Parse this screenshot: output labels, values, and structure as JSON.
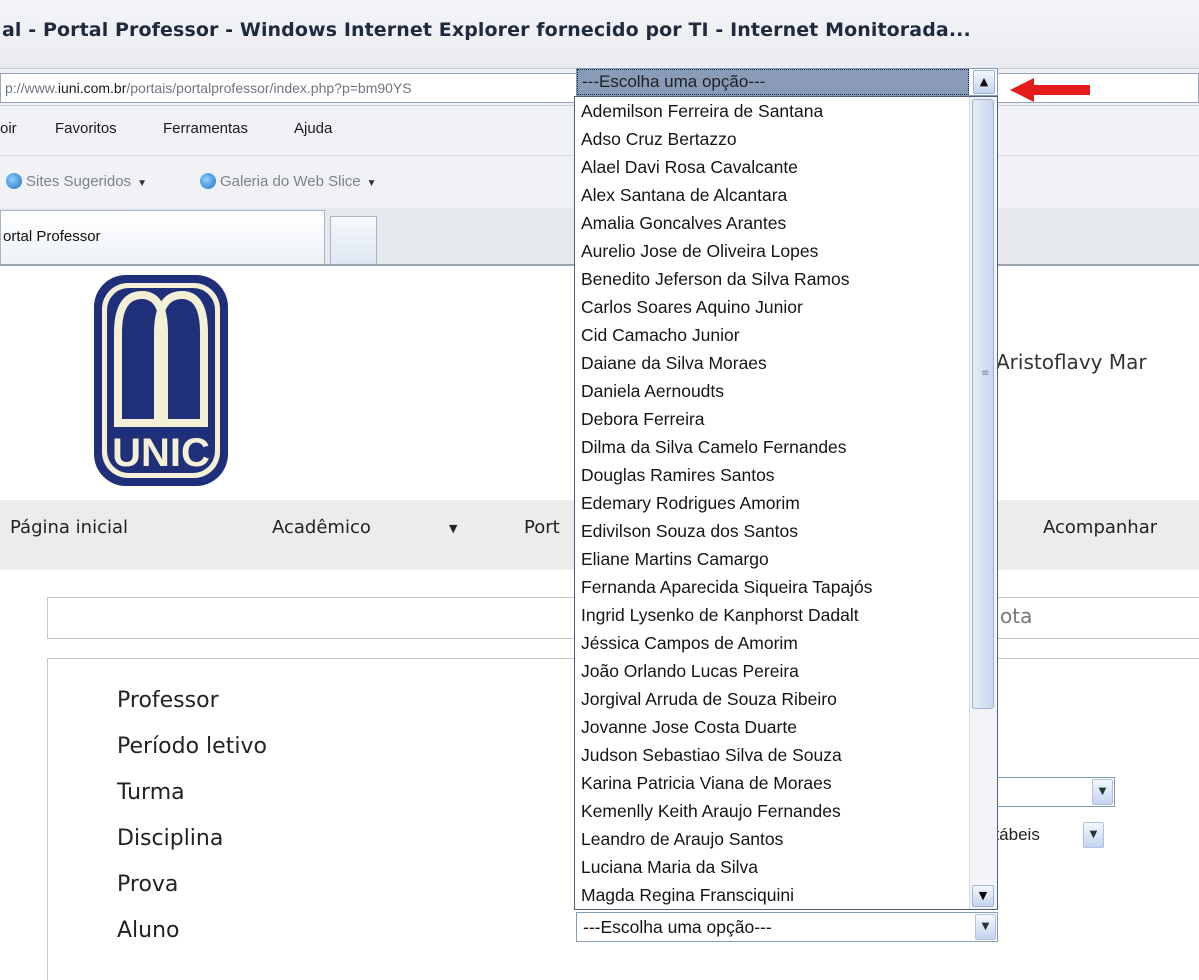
{
  "browser": {
    "title": "al - Portal Professor - Windows Internet Explorer fornecido por TI - Internet Monitorada...",
    "url_prefix": "p://www.",
    "url_domain": "iuni.com.br",
    "url_path": "/portais/portalprofessor/index.php?p=bm90YS",
    "menu": [
      "oir",
      "Favoritos",
      "Ferramentas",
      "Ajuda"
    ],
    "favorites": {
      "sites": "Sites Sugeridos",
      "webslice": "Galeria do Web Slice"
    },
    "tab_label": "ortal Professor"
  },
  "header": {
    "logo_text": "UNIC",
    "user_name": "Aristoflavy Mar"
  },
  "nav": {
    "items": [
      {
        "label": "Página inicial"
      },
      {
        "label": "Acadêmico"
      },
      {
        "label": "Port"
      },
      {
        "label": "Acompanhar"
      }
    ]
  },
  "search": {
    "visible_text": "ota"
  },
  "form": {
    "labels": [
      "Professor",
      "Período letivo",
      "Turma",
      "Disciplina",
      "Prova",
      "Aluno"
    ],
    "disciplina_value": "ntábeis"
  },
  "dropdown": {
    "selected": "---Escolha uma opção---",
    "options": [
      "Ademilson Ferreira de Santana",
      "Adso Cruz Bertazzo",
      "Alael Davi Rosa Cavalcante",
      "Alex Santana de Alcantara",
      "Amalia Goncalves Arantes",
      "Aurelio Jose de Oliveira Lopes",
      "Benedito Jeferson da Silva Ramos",
      "Carlos Soares Aquino Junior",
      "Cid Camacho Junior",
      "Daiane da Silva Moraes",
      "Daniela Aernoudts",
      "Debora Ferreira",
      "Dilma da Silva Camelo Fernandes",
      "Douglas Ramires Santos",
      "Edemary Rodrigues Amorim",
      "Edivilson Souza dos Santos",
      "Eliane Martins Camargo",
      "Fernanda Aparecida Siqueira Tapajós",
      "Ingrid Lysenko de Kanphorst Dadalt",
      "Jéssica Campos de Amorim",
      "João Orlando Lucas Pereira",
      "Jorgival Arruda de Souza Ribeiro",
      "Jovanne Jose Costa Duarte",
      "Judson Sebastiao Silva de Souza",
      "Karina Patricia Viana de Moraes",
      "Kemenlly Keith Araujo Fernandes",
      "Leandro de Araujo Santos",
      "Luciana Maria da Silva",
      "Magda Regina Fransciquini"
    ]
  },
  "aluno_select": {
    "value": "---Escolha uma opção---"
  },
  "colors": {
    "arrow": "#e31b1b",
    "logo_blue": "#1f2f7a",
    "logo_cream": "#f4f0d6"
  }
}
